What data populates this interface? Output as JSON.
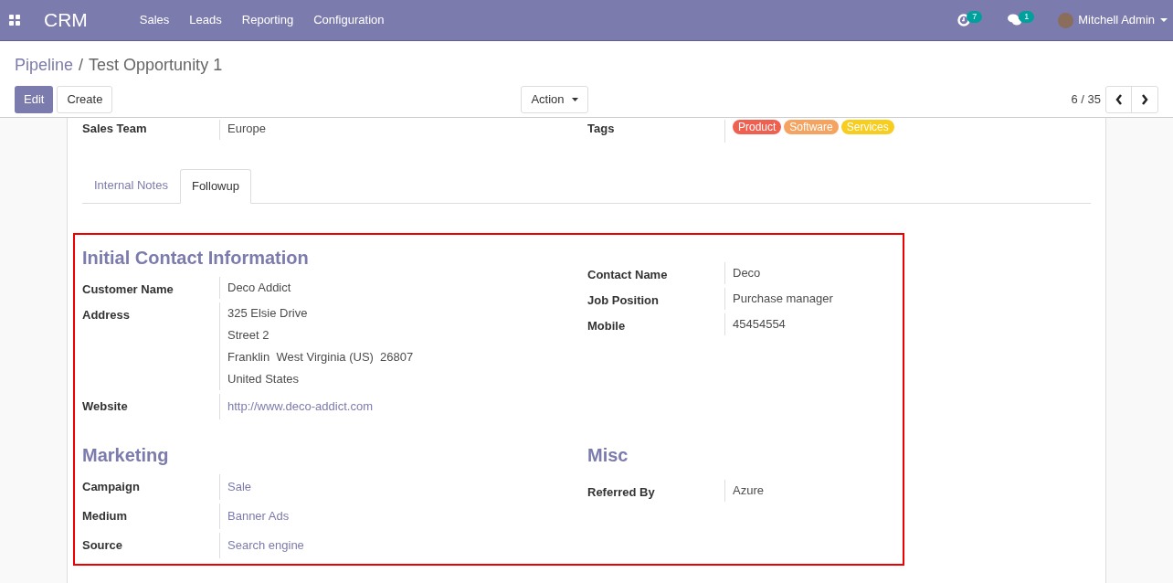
{
  "navbar": {
    "app": "CRM",
    "menu": [
      "Sales",
      "Leads",
      "Reporting",
      "Configuration"
    ],
    "activity_count": "7",
    "message_count": "1",
    "user": "Mitchell Admin"
  },
  "breadcrumb": {
    "parent": "Pipeline",
    "separator": "/",
    "current": "Test Opportunity 1"
  },
  "buttons": {
    "edit": "Edit",
    "create": "Create",
    "action": "Action"
  },
  "pager": "6 / 35",
  "top_row": {
    "left_label": "Sales Team",
    "left_value": "Europe",
    "right_label": "Tags",
    "tags": [
      {
        "label": "Product",
        "color": "#f06050"
      },
      {
        "label": "Software",
        "color": "#f4a460"
      },
      {
        "label": "Services",
        "color": "#f7cd1f"
      }
    ]
  },
  "tabs": [
    {
      "label": "Internal Notes",
      "selected": false
    },
    {
      "label": "Followup",
      "selected": true
    }
  ],
  "sections": [
    {
      "title": "Initial Contact Information",
      "left": [
        {
          "label": "Customer Name",
          "lines": [
            "Deco Addict"
          ],
          "kind": "text"
        },
        {
          "label": "Address",
          "lines": [
            "325 Elsie Drive",
            "Street 2",
            "Franklin  West Virginia (US)  26807",
            "United States"
          ],
          "kind": "text"
        },
        {
          "label": "Website",
          "lines": [
            "http://www.deco-addict.com"
          ],
          "kind": "link"
        }
      ],
      "right": [
        {
          "label": "Contact Name",
          "lines": [
            "Deco"
          ],
          "kind": "text"
        },
        {
          "label": "Job Position",
          "lines": [
            "Purchase manager"
          ],
          "kind": "text"
        },
        {
          "label": "Mobile",
          "lines": [
            "45454554"
          ],
          "kind": "text"
        }
      ]
    },
    {
      "title": "Marketing",
      "left": [
        {
          "label": "Campaign",
          "lines": [
            "Sale"
          ],
          "kind": "link"
        },
        {
          "label": "Medium",
          "lines": [
            "Banner Ads"
          ],
          "kind": "link"
        },
        {
          "label": "Source",
          "lines": [
            "Search engine"
          ],
          "kind": "link"
        }
      ],
      "right_title": "Misc",
      "right": [
        {
          "label": "Referred By",
          "lines": [
            "Azure"
          ],
          "kind": "text"
        }
      ]
    }
  ]
}
